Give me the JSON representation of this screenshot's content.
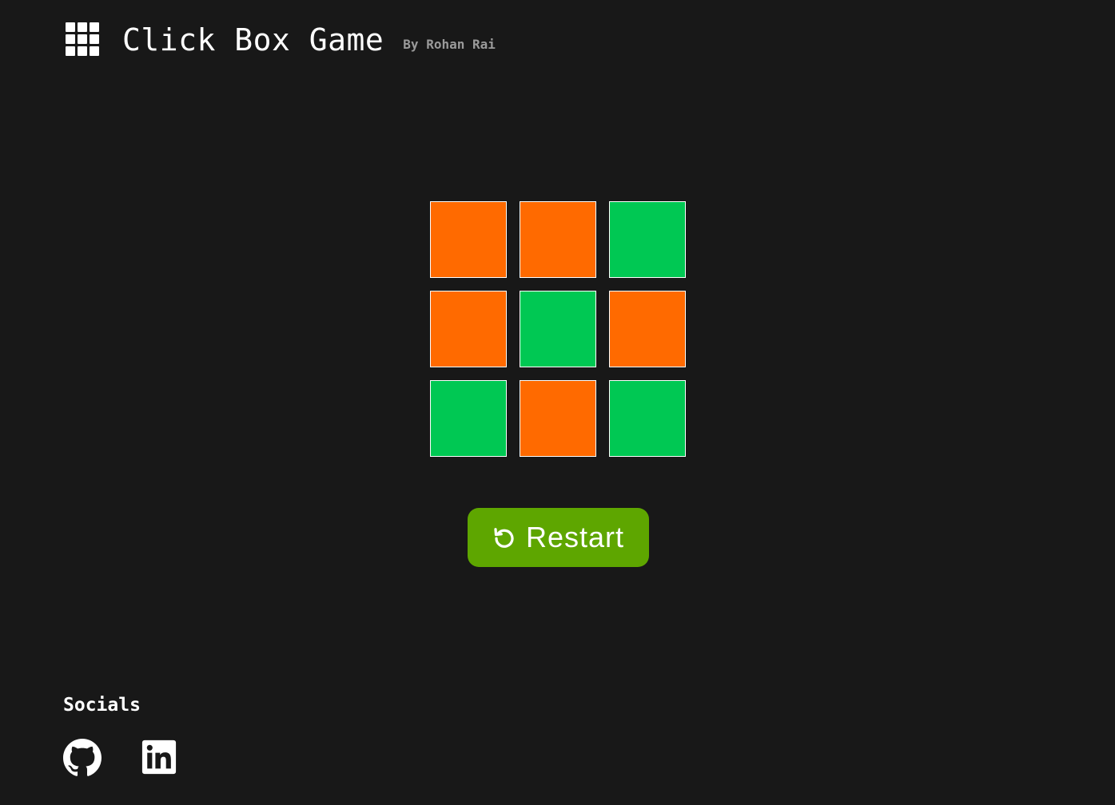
{
  "header": {
    "logo_icon": "grid-icon",
    "title": "Click Box Game",
    "byline": "By Rohan Rai"
  },
  "colors": {
    "background": "#181818",
    "orange": "#ff6a00",
    "green": "#00c853",
    "button": "#5ea600"
  },
  "board": {
    "boxes": [
      {
        "state": "orange",
        "color": "#ff6a00"
      },
      {
        "state": "orange",
        "color": "#ff6a00"
      },
      {
        "state": "green",
        "color": "#00c853"
      },
      {
        "state": "orange",
        "color": "#ff6a00"
      },
      {
        "state": "green",
        "color": "#00c853"
      },
      {
        "state": "orange",
        "color": "#ff6a00"
      },
      {
        "state": "green",
        "color": "#00c853"
      },
      {
        "state": "orange",
        "color": "#ff6a00"
      },
      {
        "state": "green",
        "color": "#00c853"
      }
    ]
  },
  "restart": {
    "icon": "restart-icon",
    "label": "Restart"
  },
  "socials": {
    "title": "Socials",
    "links": [
      {
        "icon": "github-icon"
      },
      {
        "icon": "linkedin-icon"
      }
    ]
  }
}
